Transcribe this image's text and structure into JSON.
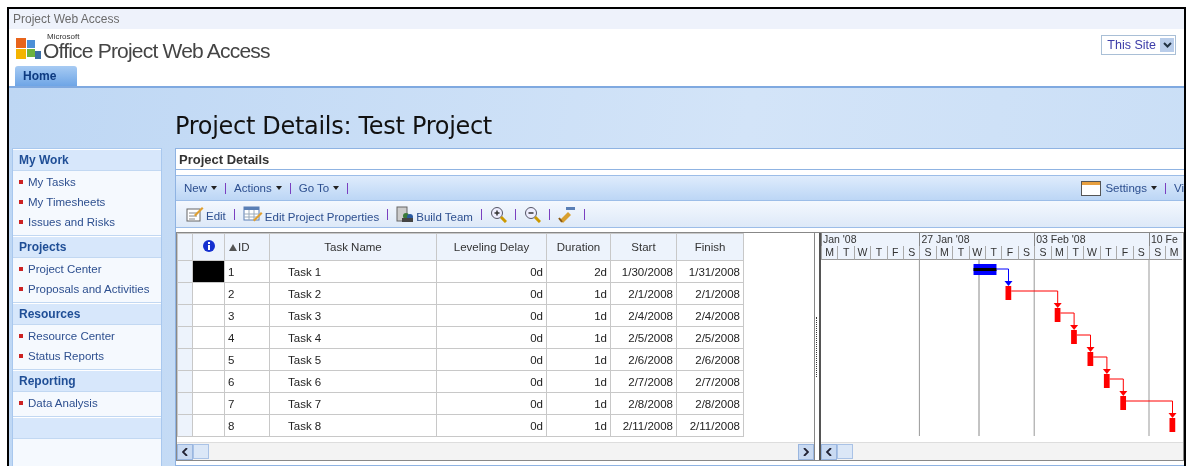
{
  "window": {
    "title": "Project Web Access"
  },
  "header": {
    "logo_small": "Microsoft",
    "logo_text": "Office Project Web Access",
    "scope": "This Site"
  },
  "tabs": [
    {
      "label": "Home",
      "selected": true
    }
  ],
  "page_title": "Project Details: Test Project",
  "sidebar": {
    "sections": [
      {
        "title": "My Work",
        "items": [
          "My Tasks",
          "My Timesheets",
          "Issues and Risks"
        ]
      },
      {
        "title": "Projects",
        "items": [
          "Project Center",
          "Proposals and Activities"
        ]
      },
      {
        "title": "Resources",
        "items": [
          "Resource Center",
          "Status Reports"
        ]
      },
      {
        "title": "Reporting",
        "items": [
          "Data Analysis"
        ]
      }
    ]
  },
  "panel": {
    "title": "Project Details",
    "menu": [
      "New",
      "Actions",
      "Go To"
    ],
    "menu_right": [
      {
        "label": "Settings",
        "kind": "settings"
      },
      {
        "label": "Vi",
        "kind": "plain"
      }
    ],
    "toolbar": [
      {
        "kind": "edit",
        "label": "Edit"
      },
      {
        "kind": "properties",
        "label": "Edit Project Properties"
      },
      {
        "kind": "team",
        "label": "Build Team"
      },
      {
        "kind": "zoom_in"
      },
      {
        "kind": "zoom_out"
      },
      {
        "kind": "filter"
      }
    ]
  },
  "table": {
    "columns": [
      {
        "label": "ID",
        "sorted": true
      },
      {
        "label": "Task Name",
        "sorted": false
      },
      {
        "label": "Leveling Delay",
        "sorted": false
      },
      {
        "label": "Duration",
        "sorted": false
      },
      {
        "label": "Start",
        "sorted": false
      },
      {
        "label": "Finish",
        "sorted": false
      }
    ],
    "rows": [
      {
        "id": "1",
        "name": "Task 1",
        "leveling_delay": "0d",
        "duration": "2d",
        "start": "1/30/2008",
        "finish": "1/31/2008",
        "selected": true,
        "critical": false
      },
      {
        "id": "2",
        "name": "Task 2",
        "leveling_delay": "0d",
        "duration": "1d",
        "start": "2/1/2008",
        "finish": "2/1/2008",
        "selected": false,
        "critical": true
      },
      {
        "id": "3",
        "name": "Task 3",
        "leveling_delay": "0d",
        "duration": "1d",
        "start": "2/4/2008",
        "finish": "2/4/2008",
        "selected": false,
        "critical": true
      },
      {
        "id": "4",
        "name": "Task 4",
        "leveling_delay": "0d",
        "duration": "1d",
        "start": "2/5/2008",
        "finish": "2/5/2008",
        "selected": false,
        "critical": true
      },
      {
        "id": "5",
        "name": "Task 5",
        "leveling_delay": "0d",
        "duration": "1d",
        "start": "2/6/2008",
        "finish": "2/6/2008",
        "selected": false,
        "critical": true
      },
      {
        "id": "6",
        "name": "Task 6",
        "leveling_delay": "0d",
        "duration": "1d",
        "start": "2/7/2008",
        "finish": "2/7/2008",
        "selected": false,
        "critical": true
      },
      {
        "id": "7",
        "name": "Task 7",
        "leveling_delay": "0d",
        "duration": "1d",
        "start": "2/8/2008",
        "finish": "2/8/2008",
        "selected": false,
        "critical": true
      },
      {
        "id": "8",
        "name": "Task 8",
        "leveling_delay": "0d",
        "duration": "1d",
        "start": "2/11/2008",
        "finish": "2/11/2008",
        "selected": false,
        "critical": true
      }
    ]
  },
  "gantt": {
    "weeks": [
      {
        "label": "Jan '08",
        "days": [
          "M",
          "T",
          "W",
          "T",
          "F",
          "S"
        ]
      },
      {
        "label": "27 Jan '08",
        "days": [
          "S",
          "M",
          "T",
          "W",
          "T",
          "F",
          "S"
        ]
      },
      {
        "label": "03 Feb '08",
        "days": [
          "S",
          "M",
          "T",
          "W",
          "T",
          "F",
          "S"
        ]
      },
      {
        "label": "10 Fe",
        "days": [
          "S",
          "M"
        ]
      }
    ]
  }
}
